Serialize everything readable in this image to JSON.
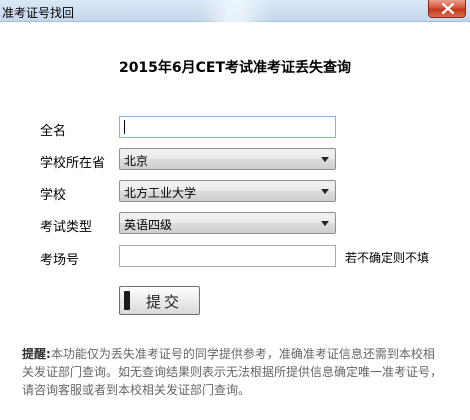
{
  "window": {
    "title": "准考证号找回"
  },
  "page": {
    "title": "2015年6月CET考试准考证丢失查询"
  },
  "form": {
    "name": {
      "label": "全名",
      "value": ""
    },
    "province": {
      "label": "学校所在省",
      "selected": "北京"
    },
    "school": {
      "label": "学校",
      "selected": "北方工业大学"
    },
    "exam_type": {
      "label": "考试类型",
      "selected": "英语四级"
    },
    "exam_room": {
      "label": "考场号",
      "value": "",
      "hint": "若不确定则不填"
    },
    "submit_label": "提交"
  },
  "notice": {
    "label": "提醒:",
    "text": "本功能仅为丢失准考证号的同学提供参考，准确准考证信息还需到本校相关发证部门查询。如无查询结果则表示无法根据所提供信息确定唯一准考证号，请咨询客服或者到本校相关发证部门查询。"
  },
  "icons": {
    "close": "close-icon",
    "dropdown": "chevron-down-icon"
  },
  "colors": {
    "titlebar": "#cfdff1",
    "close_button": "#c23a1e",
    "focus_border": "#7eb4ea",
    "notice_text": "#666666"
  }
}
